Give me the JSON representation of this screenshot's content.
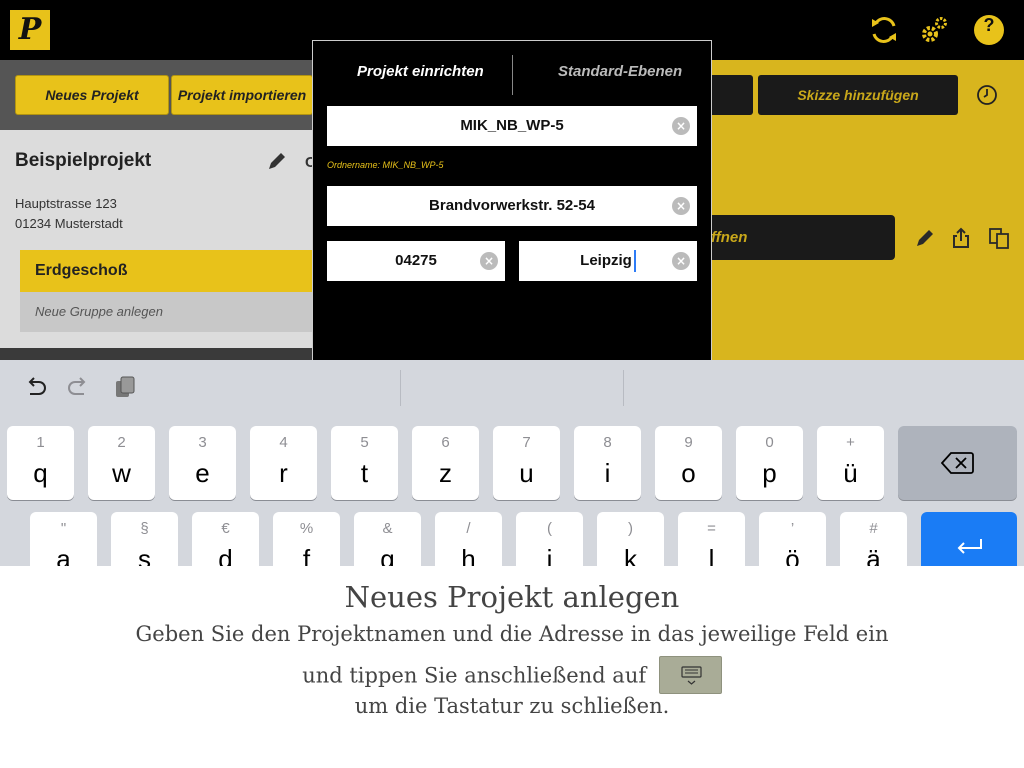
{
  "header": {
    "logo_letter": "P",
    "icons": [
      "sync-icon",
      "gear-icon",
      "help-icon"
    ],
    "help_label": "?",
    "accent_color": "#e8c21a"
  },
  "left_panel": {
    "buttons": [
      "Neues Projekt",
      "Projekt importieren"
    ],
    "project_name": "Beispielprojekt",
    "partial_letter": "C",
    "address_line1": "Hauptstrasse 123",
    "address_line2": "01234 Musterstadt",
    "floor": "Erdgeschoß",
    "new_group": "Neue Gruppe anlegen"
  },
  "right_panel": {
    "sketch_button": "Skizze hinzufügen",
    "open_button_partial": "ffnen"
  },
  "modal": {
    "tabs": [
      "Projekt einrichten",
      "Standard-Ebenen"
    ],
    "project_name_value": "MIK_NB_WP-5",
    "folder_label": "Ordnername: MIK_NB_WP-5",
    "street_value": "Brandvorwerkstr. 52-54",
    "zip_value": "04275",
    "city_value": "Leipzig",
    "clear_glyph": "×"
  },
  "keyboard": {
    "row1": [
      {
        "alt": "1",
        "key": "q"
      },
      {
        "alt": "2",
        "key": "w"
      },
      {
        "alt": "3",
        "key": "e"
      },
      {
        "alt": "4",
        "key": "r"
      },
      {
        "alt": "5",
        "key": "t"
      },
      {
        "alt": "6",
        "key": "z"
      },
      {
        "alt": "7",
        "key": "u"
      },
      {
        "alt": "8",
        "key": "i"
      },
      {
        "alt": "9",
        "key": "o"
      },
      {
        "alt": "0",
        "key": "p"
      },
      {
        "alt": "+",
        "key": "ü"
      }
    ],
    "row2": [
      {
        "alt": "\"",
        "key": "a"
      },
      {
        "alt": "§",
        "key": "s"
      },
      {
        "alt": "€",
        "key": "d"
      },
      {
        "alt": "%",
        "key": "f"
      },
      {
        "alt": "&",
        "key": "g"
      },
      {
        "alt": "/",
        "key": "h"
      },
      {
        "alt": "(",
        "key": "j"
      },
      {
        "alt": ")",
        "key": "k"
      },
      {
        "alt": "=",
        "key": "l"
      },
      {
        "alt": "’",
        "key": "ö"
      },
      {
        "alt": "#",
        "key": "ä"
      }
    ]
  },
  "instructions": {
    "title": "Neues Projekt anlegen",
    "line1": "Geben Sie den Projektnamen und die Adresse in das jeweilige Feld ein",
    "line2": "und tippen Sie anschließend auf",
    "line3": "um die Tastatur zu schließen."
  }
}
